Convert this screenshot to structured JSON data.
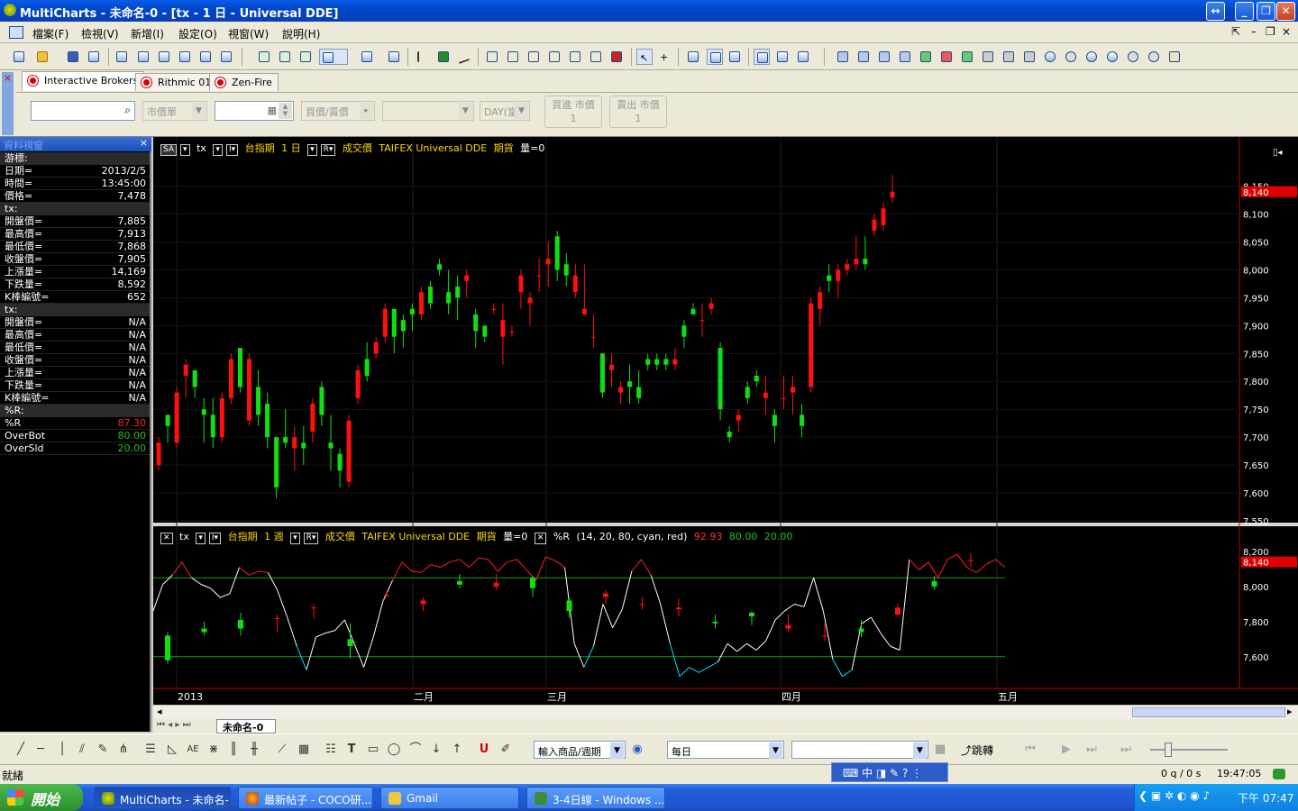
{
  "window": {
    "title": "MultiCharts - 未命名-0 - [tx - 1 日 - Universal DDE]"
  },
  "menu": [
    "檔案(F)",
    "檢視(V)",
    "新增(I)",
    "設定(O)",
    "視窗(W)",
    "說明(H)"
  ],
  "broker": {
    "tabs": [
      "Interactive Brokers",
      "Rithmic 01",
      "Zen-Fire"
    ],
    "order_type": "市價單",
    "side": "買價/賣價",
    "tif": "DAY(當",
    "buy_button": [
      "買進 市價",
      "1"
    ],
    "sell_button": [
      "賣出 市價",
      "1"
    ]
  },
  "data_window": {
    "title": "資料視窗",
    "close": "×",
    "sections": [
      {
        "header": "游標:",
        "rows": [
          [
            "日期=",
            "2013/2/5"
          ],
          [
            "時間=",
            "13:45:00"
          ],
          [
            "價格=",
            "7,478"
          ]
        ]
      },
      {
        "header": "tx:",
        "rows": [
          [
            "開盤價=",
            "7,885"
          ],
          [
            "最高價=",
            "7,913"
          ],
          [
            "最低價=",
            "7,868"
          ],
          [
            "收盤價=",
            "7,905"
          ],
          [
            "上漲量=",
            "14,169"
          ],
          [
            "下跌量=",
            "8,592"
          ],
          [
            "K棒編號=",
            "652"
          ]
        ]
      },
      {
        "header": "tx:",
        "rows": [
          [
            "開盤價=",
            "N/A"
          ],
          [
            "最高價=",
            "N/A"
          ],
          [
            "最低價=",
            "N/A"
          ],
          [
            "收盤價=",
            "N/A"
          ],
          [
            "上漲量=",
            "N/A"
          ],
          [
            "下跌量=",
            "N/A"
          ],
          [
            "K棒編號=",
            "N/A"
          ]
        ]
      },
      {
        "header": "%R:",
        "rows": [
          [
            "%R",
            "87.30"
          ],
          [
            "OverBot",
            "80.00"
          ],
          [
            "OverSld",
            "20.00"
          ]
        ]
      }
    ],
    "value_colors": {
      "%R": "#ff2020",
      "OverBot": "#20c020",
      "OverSld": "#20c020"
    }
  },
  "chart": {
    "legend_top": {
      "sa": "SA",
      "symbol": "tx",
      "name": "台指期",
      "interval": "1 日",
      "field": "成交價",
      "source": "TAIFEX Universal DDE",
      "kind": "期貨",
      "qty": "量=0"
    },
    "legend_bottom": {
      "symbol": "tx",
      "name": "台指期",
      "interval": "1 週",
      "field": "成交價",
      "source": "TAIFEX Universal DDE",
      "kind": "期貨",
      "qty": "量=0",
      "indicator": "%R",
      "params": "(14, 20, 80, cyan, red)",
      "v1": "92.93",
      "v2": "80.00",
      "v3": "20.00"
    },
    "price_axis_top": [
      "8,150",
      "8,100",
      "8,050",
      "8,000",
      "7,950",
      "7,900",
      "7,850",
      "7,800",
      "7,750",
      "7,700",
      "7,650",
      "7,600",
      "7,550"
    ],
    "price_axis_bottom": [
      "8,200",
      "8,000",
      "7,800",
      "7,600"
    ],
    "last_price": "8,140",
    "date_labels": [
      "2013",
      "二月",
      "三月",
      "四月",
      "五月"
    ],
    "colors": {
      "up": "#ff1010",
      "down": "#10e010",
      "bg": "#000000"
    }
  },
  "chart_data": [
    {
      "type": "candlestick",
      "title": "tx 台指期 1 日",
      "ylim": [
        7550,
        8180
      ],
      "candles": [
        [
          7650,
          7700,
          7640,
          7690
        ],
        [
          7740,
          7740,
          7690,
          7720
        ],
        [
          7690,
          7790,
          7680,
          7780
        ],
        [
          7810,
          7840,
          7770,
          7830
        ],
        [
          7820,
          7820,
          7770,
          7790
        ],
        [
          7750,
          7770,
          7690,
          7740
        ],
        [
          7740,
          7770,
          7680,
          7700
        ],
        [
          7700,
          7780,
          7690,
          7770
        ],
        [
          7770,
          7850,
          7760,
          7840
        ],
        [
          7860,
          7860,
          7780,
          7790
        ],
        [
          7730,
          7850,
          7720,
          7840
        ],
        [
          7790,
          7820,
          7720,
          7740
        ],
        [
          7760,
          7780,
          7680,
          7700
        ],
        [
          7700,
          7700,
          7590,
          7610
        ],
        [
          7700,
          7750,
          7680,
          7690
        ],
        [
          7680,
          7720,
          7640,
          7700
        ],
        [
          7690,
          7720,
          7650,
          7680
        ],
        [
          7710,
          7770,
          7690,
          7760
        ],
        [
          7790,
          7800,
          7720,
          7740
        ],
        [
          7690,
          7740,
          7640,
          7680
        ],
        [
          7670,
          7680,
          7610,
          7640
        ],
        [
          7620,
          7740,
          7610,
          7730
        ],
        [
          7770,
          7830,
          7760,
          7820
        ],
        [
          7840,
          7870,
          7800,
          7810
        ],
        [
          7850,
          7880,
          7840,
          7870
        ],
        [
          7880,
          7940,
          7870,
          7930
        ],
        [
          7930,
          7930,
          7850,
          7880
        ],
        [
          7910,
          7920,
          7860,
          7890
        ],
        [
          7930,
          7940,
          7890,
          7920
        ],
        [
          7920,
          7970,
          7910,
          7960
        ],
        [
          7970,
          7980,
          7930,
          7940
        ],
        [
          8010,
          8020,
          7990,
          8000
        ],
        [
          7960,
          8000,
          7920,
          7940
        ],
        [
          7970,
          7990,
          7910,
          7950
        ],
        [
          7980,
          8000,
          7950,
          7990
        ],
        [
          7920,
          7930,
          7860,
          7890
        ],
        [
          7900,
          7900,
          7870,
          7880
        ],
        [
          7930,
          7940,
          7920,
          7930
        ],
        [
          7880,
          7940,
          7830,
          7910
        ],
        [
          7890,
          7900,
          7880,
          7890
        ],
        [
          7960,
          8000,
          7930,
          7990
        ],
        [
          7940,
          7960,
          7900,
          7950
        ],
        [
          7990,
          8020,
          7960,
          7990
        ],
        [
          8010,
          8050,
          7970,
          8020
        ],
        [
          8060,
          8070,
          7980,
          8000
        ],
        [
          8010,
          8030,
          7970,
          7990
        ],
        [
          7960,
          8010,
          7950,
          7990
        ],
        [
          7920,
          8010,
          7920,
          7930
        ],
        [
          7880,
          7920,
          7860,
          7880
        ],
        [
          7850,
          7850,
          7770,
          7780
        ],
        [
          7820,
          7850,
          7790,
          7830
        ],
        [
          7780,
          7800,
          7760,
          7790
        ],
        [
          7800,
          7830,
          7760,
          7790
        ],
        [
          7790,
          7820,
          7760,
          7770
        ],
        [
          7840,
          7850,
          7820,
          7830
        ],
        [
          7840,
          7850,
          7820,
          7830
        ],
        [
          7840,
          7850,
          7820,
          7830
        ],
        [
          7830,
          7860,
          7820,
          7840
        ],
        [
          7900,
          7910,
          7860,
          7880
        ],
        [
          7930,
          7940,
          7920,
          7920
        ],
        [
          7910,
          7940,
          7880,
          7910
        ],
        [
          7930,
          7950,
          7920,
          7940
        ],
        [
          7860,
          7870,
          7730,
          7750
        ],
        [
          7710,
          7720,
          7690,
          7700
        ],
        [
          7730,
          7750,
          7710,
          7740
        ],
        [
          7790,
          7800,
          7760,
          7770
        ],
        [
          7810,
          7820,
          7790,
          7800
        ],
        [
          7770,
          7810,
          7740,
          7780
        ],
        [
          7740,
          7750,
          7690,
          7720
        ],
        [
          7770,
          7810,
          7750,
          7770
        ],
        [
          7780,
          7810,
          7740,
          7790
        ],
        [
          7740,
          7760,
          7700,
          7720
        ],
        [
          7790,
          7950,
          7780,
          7940
        ],
        [
          7930,
          7970,
          7900,
          7960
        ],
        [
          7990,
          8010,
          7960,
          7980
        ],
        [
          7980,
          8010,
          7950,
          8000
        ],
        [
          8000,
          8020,
          7990,
          8010
        ],
        [
          8010,
          8060,
          8000,
          8020
        ],
        [
          8020,
          8060,
          8000,
          8010
        ],
        [
          8070,
          8100,
          8060,
          8090
        ],
        [
          8080,
          8120,
          8070,
          8110
        ],
        [
          8130,
          8170,
          8120,
          8140
        ]
      ]
    },
    {
      "type": "line",
      "title": "%R (14, 20, 80, cyan, red)",
      "ylim": [
        0,
        100
      ],
      "overbought": 80,
      "oversold": 20,
      "values": [
        55,
        75,
        82,
        92,
        80,
        75,
        72,
        65,
        68,
        88,
        82,
        85,
        84,
        70,
        50,
        28,
        10,
        35,
        38,
        40,
        48,
        30,
        12,
        35,
        62,
        78,
        92,
        85,
        84,
        90,
        88,
        92,
        94,
        88,
        95,
        94,
        85,
        92,
        94,
        86,
        78,
        96,
        93,
        88,
        30,
        12,
        28,
        60,
        42,
        56,
        85,
        94,
        82,
        60,
        30,
        5,
        12,
        8,
        12,
        16,
        30,
        24,
        30,
        25,
        32,
        48,
        55,
        60,
        58,
        80,
        55,
        18,
        5,
        10,
        45,
        50,
        38,
        28,
        25,
        94,
        86,
        92,
        80,
        94,
        98,
        88,
        84,
        90,
        94,
        88
      ]
    },
    {
      "type": "candlestick",
      "title": "tx 台指期 1 週",
      "ylim": [
        7440,
        8240
      ],
      "candles": [
        [
          7720,
          7740,
          7560,
          7580
        ],
        [
          7760,
          7800,
          7720,
          7740
        ],
        [
          7810,
          7850,
          7720,
          7760
        ],
        [
          7820,
          7840,
          7740,
          7820
        ],
        [
          7880,
          7900,
          7820,
          7880
        ],
        [
          7700,
          7790,
          7590,
          7660
        ],
        [
          7950,
          7970,
          7940,
          7950
        ],
        [
          7900,
          7940,
          7860,
          7920
        ],
        [
          8030,
          8070,
          7990,
          8010
        ],
        [
          8000,
          8070,
          7980,
          8020
        ],
        [
          8050,
          8060,
          7940,
          7990
        ],
        [
          7920,
          7940,
          7820,
          7860
        ],
        [
          7940,
          7980,
          7900,
          7960
        ],
        [
          7900,
          7940,
          7870,
          7900
        ],
        [
          7870,
          7930,
          7830,
          7880
        ],
        [
          7800,
          7840,
          7760,
          7790
        ],
        [
          7850,
          7860,
          7780,
          7830
        ],
        [
          7760,
          7840,
          7740,
          7780
        ],
        [
          7720,
          7790,
          7690,
          7720
        ],
        [
          7760,
          7810,
          7710,
          7740
        ],
        [
          7840,
          7900,
          7830,
          7880
        ],
        [
          8030,
          8060,
          7980,
          8000
        ],
        [
          8150,
          8190,
          8110,
          8150
        ]
      ]
    }
  ],
  "bottom": {
    "sheet_tab": "未命名-0",
    "symbol_combo": "輸入商品/週期",
    "period_combo": "每日",
    "goto": "跳轉",
    "status": "就緒",
    "timer": "0 q / 0 s",
    "clock": "19:47:05"
  },
  "taskbar": {
    "start": "開始",
    "tasks": [
      "MultiCharts - 未命名-...",
      "最新帖子 - COCO研...",
      "Gmail",
      "3-4日線 - Windows ..."
    ],
    "time": "下午 07:47"
  }
}
